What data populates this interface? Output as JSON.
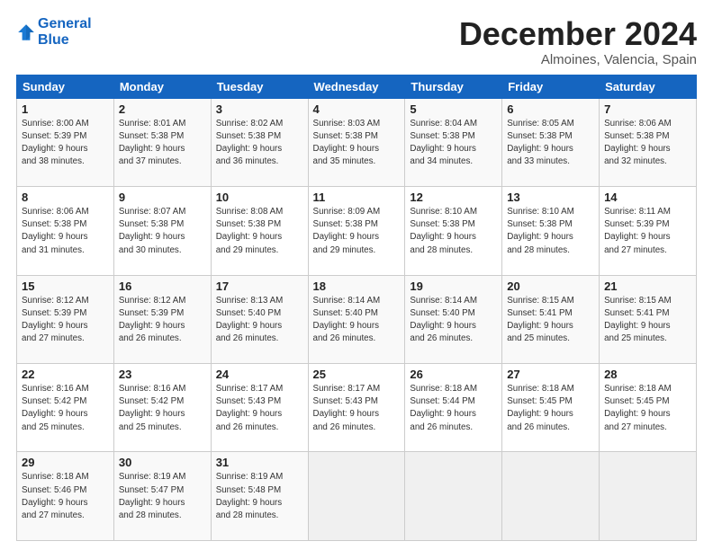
{
  "header": {
    "logo_line1": "General",
    "logo_line2": "Blue",
    "title": "December 2024",
    "subtitle": "Almoines, Valencia, Spain"
  },
  "weekdays": [
    "Sunday",
    "Monday",
    "Tuesday",
    "Wednesday",
    "Thursday",
    "Friday",
    "Saturday"
  ],
  "weeks": [
    [
      {
        "day": "1",
        "info": "Sunrise: 8:00 AM\nSunset: 5:39 PM\nDaylight: 9 hours\nand 38 minutes."
      },
      {
        "day": "2",
        "info": "Sunrise: 8:01 AM\nSunset: 5:38 PM\nDaylight: 9 hours\nand 37 minutes."
      },
      {
        "day": "3",
        "info": "Sunrise: 8:02 AM\nSunset: 5:38 PM\nDaylight: 9 hours\nand 36 minutes."
      },
      {
        "day": "4",
        "info": "Sunrise: 8:03 AM\nSunset: 5:38 PM\nDaylight: 9 hours\nand 35 minutes."
      },
      {
        "day": "5",
        "info": "Sunrise: 8:04 AM\nSunset: 5:38 PM\nDaylight: 9 hours\nand 34 minutes."
      },
      {
        "day": "6",
        "info": "Sunrise: 8:05 AM\nSunset: 5:38 PM\nDaylight: 9 hours\nand 33 minutes."
      },
      {
        "day": "7",
        "info": "Sunrise: 8:06 AM\nSunset: 5:38 PM\nDaylight: 9 hours\nand 32 minutes."
      }
    ],
    [
      {
        "day": "8",
        "info": "Sunrise: 8:06 AM\nSunset: 5:38 PM\nDaylight: 9 hours\nand 31 minutes."
      },
      {
        "day": "9",
        "info": "Sunrise: 8:07 AM\nSunset: 5:38 PM\nDaylight: 9 hours\nand 30 minutes."
      },
      {
        "day": "10",
        "info": "Sunrise: 8:08 AM\nSunset: 5:38 PM\nDaylight: 9 hours\nand 29 minutes."
      },
      {
        "day": "11",
        "info": "Sunrise: 8:09 AM\nSunset: 5:38 PM\nDaylight: 9 hours\nand 29 minutes."
      },
      {
        "day": "12",
        "info": "Sunrise: 8:10 AM\nSunset: 5:38 PM\nDaylight: 9 hours\nand 28 minutes."
      },
      {
        "day": "13",
        "info": "Sunrise: 8:10 AM\nSunset: 5:38 PM\nDaylight: 9 hours\nand 28 minutes."
      },
      {
        "day": "14",
        "info": "Sunrise: 8:11 AM\nSunset: 5:39 PM\nDaylight: 9 hours\nand 27 minutes."
      }
    ],
    [
      {
        "day": "15",
        "info": "Sunrise: 8:12 AM\nSunset: 5:39 PM\nDaylight: 9 hours\nand 27 minutes."
      },
      {
        "day": "16",
        "info": "Sunrise: 8:12 AM\nSunset: 5:39 PM\nDaylight: 9 hours\nand 26 minutes."
      },
      {
        "day": "17",
        "info": "Sunrise: 8:13 AM\nSunset: 5:40 PM\nDaylight: 9 hours\nand 26 minutes."
      },
      {
        "day": "18",
        "info": "Sunrise: 8:14 AM\nSunset: 5:40 PM\nDaylight: 9 hours\nand 26 minutes."
      },
      {
        "day": "19",
        "info": "Sunrise: 8:14 AM\nSunset: 5:40 PM\nDaylight: 9 hours\nand 26 minutes."
      },
      {
        "day": "20",
        "info": "Sunrise: 8:15 AM\nSunset: 5:41 PM\nDaylight: 9 hours\nand 25 minutes."
      },
      {
        "day": "21",
        "info": "Sunrise: 8:15 AM\nSunset: 5:41 PM\nDaylight: 9 hours\nand 25 minutes."
      }
    ],
    [
      {
        "day": "22",
        "info": "Sunrise: 8:16 AM\nSunset: 5:42 PM\nDaylight: 9 hours\nand 25 minutes."
      },
      {
        "day": "23",
        "info": "Sunrise: 8:16 AM\nSunset: 5:42 PM\nDaylight: 9 hours\nand 25 minutes."
      },
      {
        "day": "24",
        "info": "Sunrise: 8:17 AM\nSunset: 5:43 PM\nDaylight: 9 hours\nand 26 minutes."
      },
      {
        "day": "25",
        "info": "Sunrise: 8:17 AM\nSunset: 5:43 PM\nDaylight: 9 hours\nand 26 minutes."
      },
      {
        "day": "26",
        "info": "Sunrise: 8:18 AM\nSunset: 5:44 PM\nDaylight: 9 hours\nand 26 minutes."
      },
      {
        "day": "27",
        "info": "Sunrise: 8:18 AM\nSunset: 5:45 PM\nDaylight: 9 hours\nand 26 minutes."
      },
      {
        "day": "28",
        "info": "Sunrise: 8:18 AM\nSunset: 5:45 PM\nDaylight: 9 hours\nand 27 minutes."
      }
    ],
    [
      {
        "day": "29",
        "info": "Sunrise: 8:18 AM\nSunset: 5:46 PM\nDaylight: 9 hours\nand 27 minutes."
      },
      {
        "day": "30",
        "info": "Sunrise: 8:19 AM\nSunset: 5:47 PM\nDaylight: 9 hours\nand 28 minutes."
      },
      {
        "day": "31",
        "info": "Sunrise: 8:19 AM\nSunset: 5:48 PM\nDaylight: 9 hours\nand 28 minutes."
      },
      null,
      null,
      null,
      null
    ]
  ]
}
